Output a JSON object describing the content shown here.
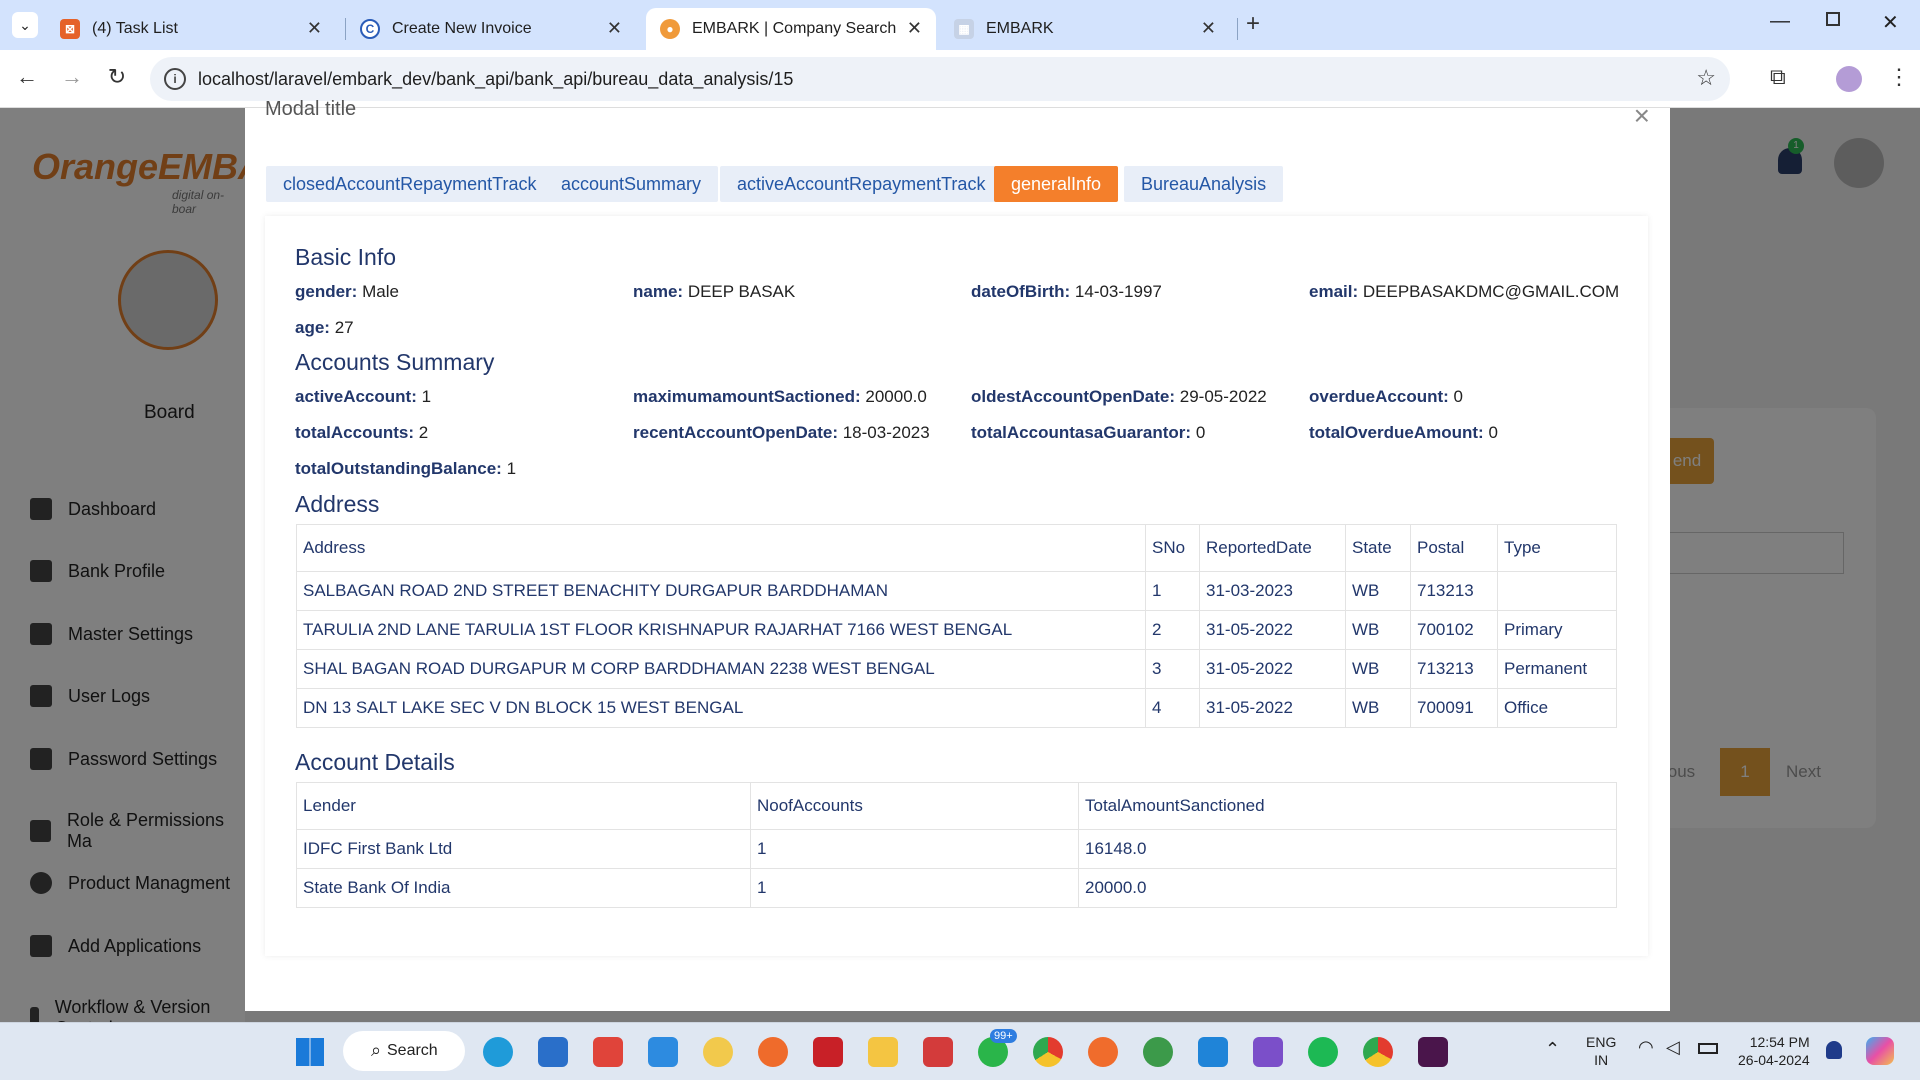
{
  "browser": {
    "tabs": [
      {
        "label": "(4) Task List"
      },
      {
        "label": "Create New Invoice"
      },
      {
        "label": "EMBARK | Company Search"
      },
      {
        "label": "EMBARK"
      }
    ],
    "url": "localhost/laravel/embark_dev/bank_api/bank_api/bureau_data_analysis/15"
  },
  "app": {
    "logo": "OrangeEMBA",
    "logo_tagline": "digital on-boar",
    "board_label": "Board",
    "notification_count": "1",
    "sidebar": [
      {
        "label": "Dashboard"
      },
      {
        "label": "Bank Profile"
      },
      {
        "label": "Master Settings"
      },
      {
        "label": "User Logs"
      },
      {
        "label": "Password Settings"
      },
      {
        "label": "Role & Permissions Ma"
      },
      {
        "label": "Product Managment"
      },
      {
        "label": "Add Applications"
      },
      {
        "label": "Workflow & Version Control"
      }
    ],
    "bg_button": "end",
    "bg_prev": "ious",
    "bg_page": "1",
    "bg_next": "Next"
  },
  "modal": {
    "title": "Modal title",
    "tabs": [
      "closedAccountRepaymentTrack",
      "accountSummary",
      "activeAccountRepaymentTrack",
      "generalInfo",
      "BureauAnalysis"
    ],
    "basic_info": {
      "heading": "Basic Info",
      "gender_k": "gender:",
      "gender_v": "Male",
      "name_k": "name:",
      "name_v": "DEEP BASAK",
      "dob_k": "dateOfBirth:",
      "dob_v": "14-03-1997",
      "email_k": "email:",
      "email_v": "DEEPBASAKDMC@GMAIL.COM",
      "age_k": "age:",
      "age_v": "27"
    },
    "accounts_summary": {
      "heading": "Accounts Summary",
      "active_k": "activeAccount:",
      "active_v": "1",
      "maxsanc_k": "maximumamountSactioned:",
      "maxsanc_v": "20000.0",
      "oldest_k": "oldestAccountOpenDate:",
      "oldest_v": "29-05-2022",
      "overdue_k": "overdueAccount:",
      "overdue_v": "0",
      "total_k": "totalAccounts:",
      "total_v": "2",
      "recent_k": "recentAccountOpenDate:",
      "recent_v": "18-03-2023",
      "guar_k": "totalAccountasaGuarantor:",
      "guar_v": "0",
      "overamt_k": "totalOverdueAmount:",
      "overamt_v": "0",
      "outst_k": "totalOutstandingBalance:",
      "outst_v": "1"
    },
    "address": {
      "heading": "Address",
      "columns": [
        "Address",
        "SNo",
        "ReportedDate",
        "State",
        "Postal",
        "Type"
      ],
      "rows": [
        [
          "SALBAGAN ROAD 2ND STREET BENACHITY DURGAPUR BARDDHAMAN",
          "1",
          "31-03-2023",
          "WB",
          "713213",
          ""
        ],
        [
          "TARULIA 2ND LANE TARULIA 1ST FLOOR KRISHNAPUR RAJARHAT 7166 WEST BENGAL",
          "2",
          "31-05-2022",
          "WB",
          "700102",
          "Primary"
        ],
        [
          "SHAL BAGAN ROAD DURGAPUR M CORP BARDDHAMAN 2238 WEST BENGAL",
          "3",
          "31-05-2022",
          "WB",
          "713213",
          "Permanent"
        ],
        [
          "DN 13 SALT LAKE SEC V DN BLOCK 15 WEST BENGAL",
          "4",
          "31-05-2022",
          "WB",
          "700091",
          "Office"
        ]
      ]
    },
    "account_details": {
      "heading": "Account Details",
      "columns": [
        "Lender",
        "NoofAccounts",
        "TotalAmountSanctioned"
      ],
      "rows": [
        [
          "IDFC First Bank Ltd",
          "1",
          "16148.0"
        ],
        [
          "State Bank Of India",
          "1",
          "20000.0"
        ]
      ]
    }
  },
  "taskbar": {
    "search": "Search",
    "badge": "99+",
    "lang1": "ENG",
    "lang2": "IN",
    "time": "12:54 PM",
    "date": "26-04-2024"
  },
  "colors": {
    "accent": "#f47f2b",
    "heading": "#22376b",
    "tab_bg": "#e8eef8"
  }
}
